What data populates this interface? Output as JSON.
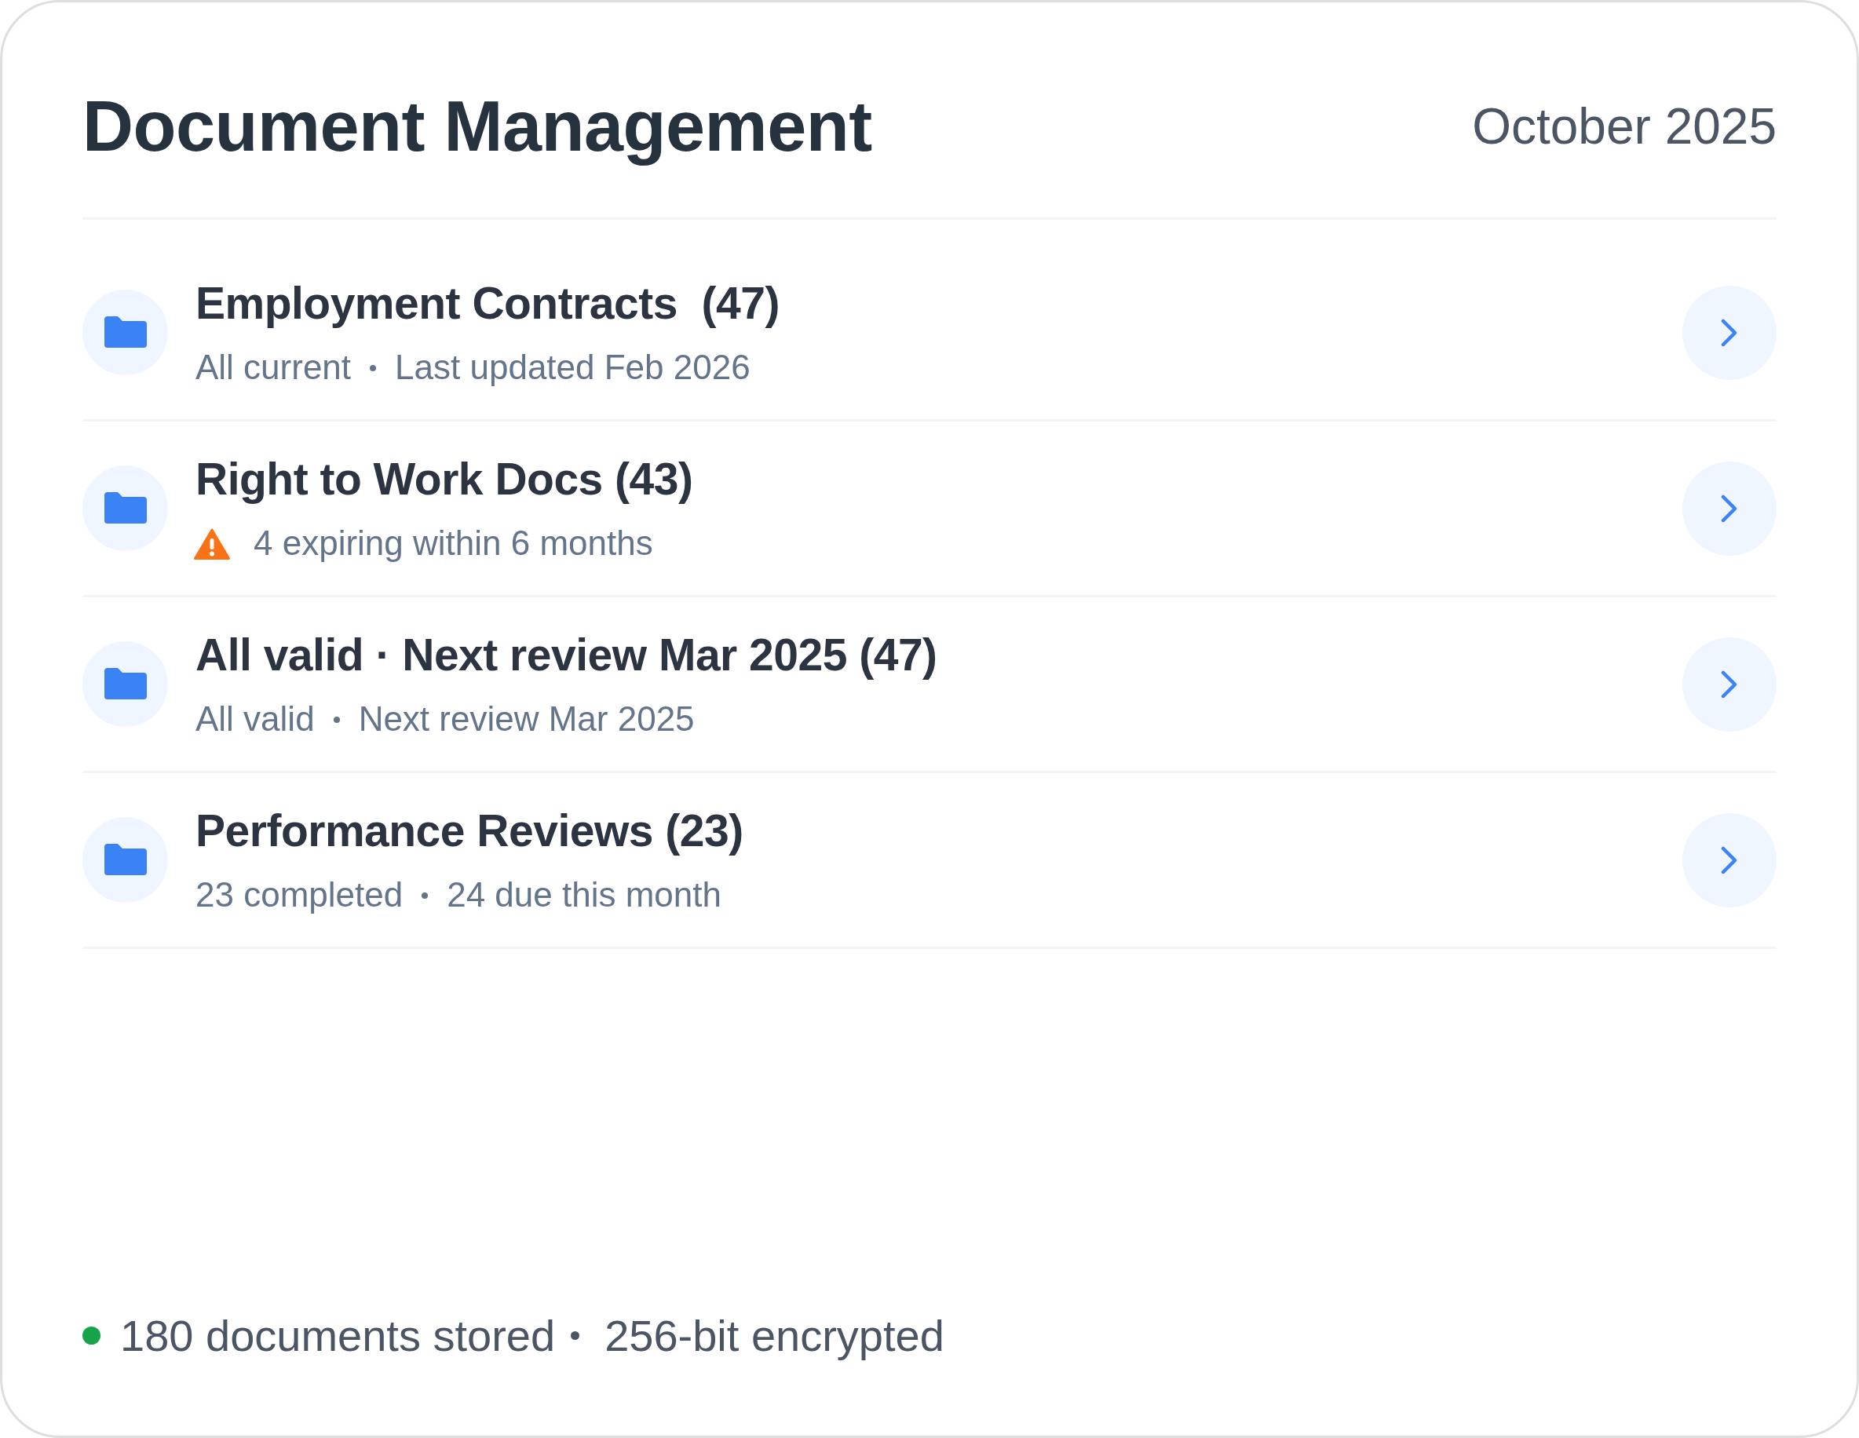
{
  "header": {
    "title": "Document Management",
    "date": "October 2025"
  },
  "folders": [
    {
      "title": "Employment Contracts  (47)",
      "kind": "details",
      "details": [
        "All current",
        "Last updated Feb 2026"
      ]
    },
    {
      "title": "Right to Work Docs (43)",
      "kind": "warning",
      "details": [
        "4 expiring within 6 months"
      ]
    },
    {
      "title": "All valid · Next review Mar 2025 (47)",
      "kind": "details",
      "details": [
        "All valid",
        "Next review Mar 2025"
      ]
    },
    {
      "title": "Performance Reviews (23)",
      "kind": "details",
      "details": [
        "23 completed",
        "24 due this month"
      ]
    }
  ],
  "footer": {
    "items": [
      "180 documents stored",
      "256-bit encrypted"
    ]
  }
}
